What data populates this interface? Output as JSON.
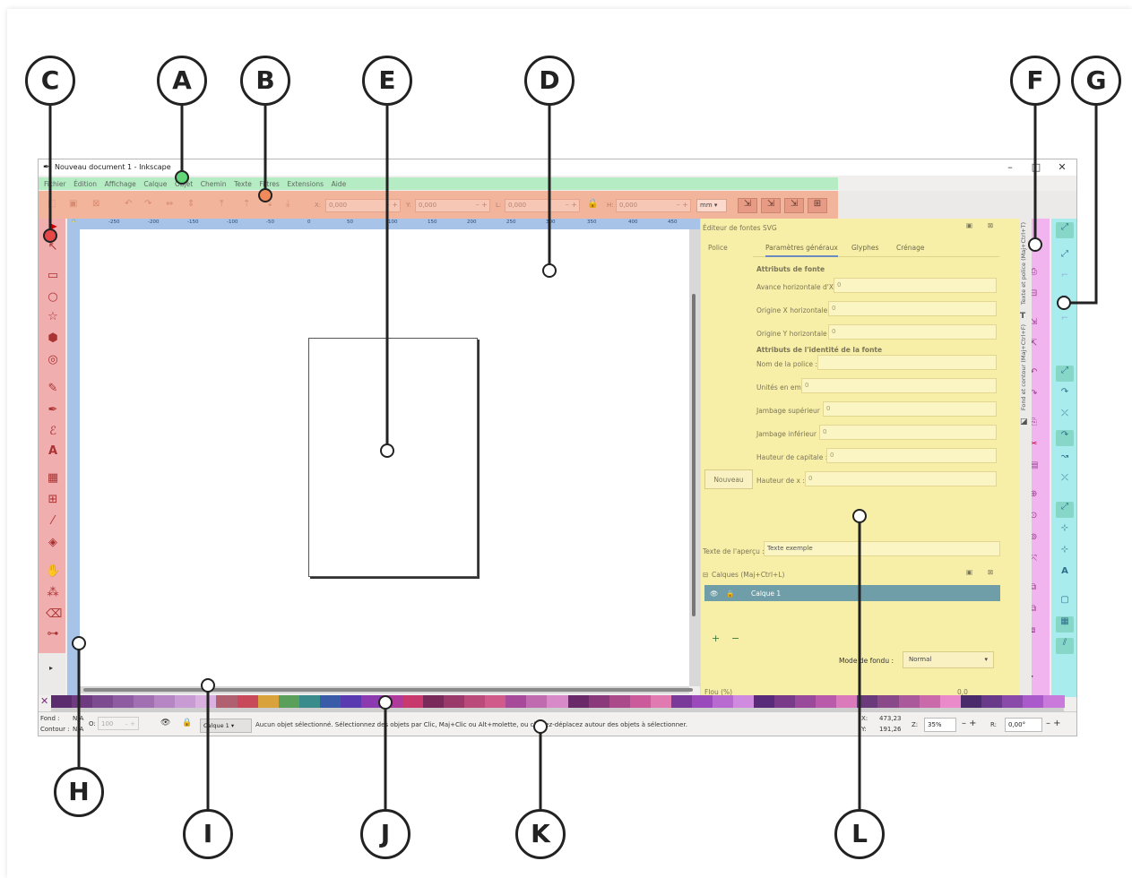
{
  "window": {
    "title": "Nouveau document 1 - Inkscape",
    "controls": {
      "minimize": "–",
      "maximize": "□",
      "close": "✕"
    }
  },
  "menu": [
    "Fichier",
    "Édition",
    "Affichage",
    "Calque",
    "Objet",
    "Chemin",
    "Texte",
    "Filtres",
    "Extensions",
    "Aide"
  ],
  "control_bar": {
    "x_label": "X:",
    "x_value": "0,000",
    "y_label": "Y:",
    "y_value": "0,000",
    "w_label": "L:",
    "w_value": "0,000",
    "h_label": "H:",
    "h_value": "0,000",
    "unit": "mm ▾",
    "pm": "– +"
  },
  "ruler_ticks": [
    "-250",
    "-200",
    "-150",
    "-100",
    "-50",
    "0",
    "50",
    "100",
    "150",
    "200",
    "250",
    "300",
    "350",
    "400",
    "450"
  ],
  "font_editor": {
    "title": "Éditeur de fontes SVG",
    "font_label": "Police",
    "tabs": [
      "Paramètres généraux",
      "Glyphes",
      "Crénage"
    ],
    "section1": "Attributs de fonte",
    "fields1": [
      {
        "label": "Avance horizontale d'X",
        "value": "0"
      },
      {
        "label": "Origine X horizontale",
        "value": "0"
      },
      {
        "label": "Origine Y horizontale",
        "value": "0"
      }
    ],
    "section2": "Attributs de l'identité de la fonte",
    "font_name_label": "Nom de la police :",
    "fields2": [
      {
        "label": "Unités en em",
        "value": "0"
      },
      {
        "label": "Jambage supérieur :",
        "value": "0"
      },
      {
        "label": "Jambage inférieur :",
        "value": "0"
      },
      {
        "label": "Hauteur de capitale :",
        "value": "0"
      },
      {
        "label": "Hauteur de x :",
        "value": "0"
      }
    ],
    "new_button": "Nouveau",
    "preview_label": "Texte de l'aperçu :",
    "preview_value": "Texte exemple"
  },
  "layers_panel": {
    "title": "Calques (Maj+Ctrl+L)",
    "layer_name": "Calque 1",
    "add": "+",
    "remove": "−",
    "blend_label": "Mode de fondu :",
    "blend_value": "Normal",
    "blur_label": "Flou (%)",
    "blur_value": "0,0"
  },
  "vertical_tabs": [
    "Texte et police (Maj+Ctrl+T)",
    "Fond et contour (Maj+Ctrl+F)"
  ],
  "status": {
    "fill_label": "Fond :",
    "fill_value": "N/A",
    "stroke_label": "Contour :",
    "stroke_value": "N/A",
    "opacity_label": "O:",
    "opacity_value": "100",
    "layer_button": "Calque 1 ▾",
    "message": "Aucun objet sélectionné. Sélectionnez des objets par Clic, Maj+Clic ou Alt+molette, ou cliquez-déplacez autour des objets à sélectionner.",
    "x_label": "X:",
    "x_value": "473,23",
    "y_label": "Y:",
    "y_value": "191,26",
    "zoom_label": "Z:",
    "zoom_value": "35%",
    "rot_label": "R:",
    "rot_value": "0,00°"
  },
  "callouts": [
    "A",
    "B",
    "C",
    "D",
    "E",
    "F",
    "G",
    "H",
    "I",
    "J",
    "K",
    "L"
  ],
  "colors": {
    "menu_highlight": "#b6ecc3",
    "controls_highlight": "#f3b49c",
    "toolbox_highlight": "#f1aeae",
    "ruler_highlight": "#a7c4e8",
    "dock_highlight": "#f7eea8",
    "commands_highlight": "#f2b4ee",
    "snap_highlight": "#a9ecee"
  }
}
